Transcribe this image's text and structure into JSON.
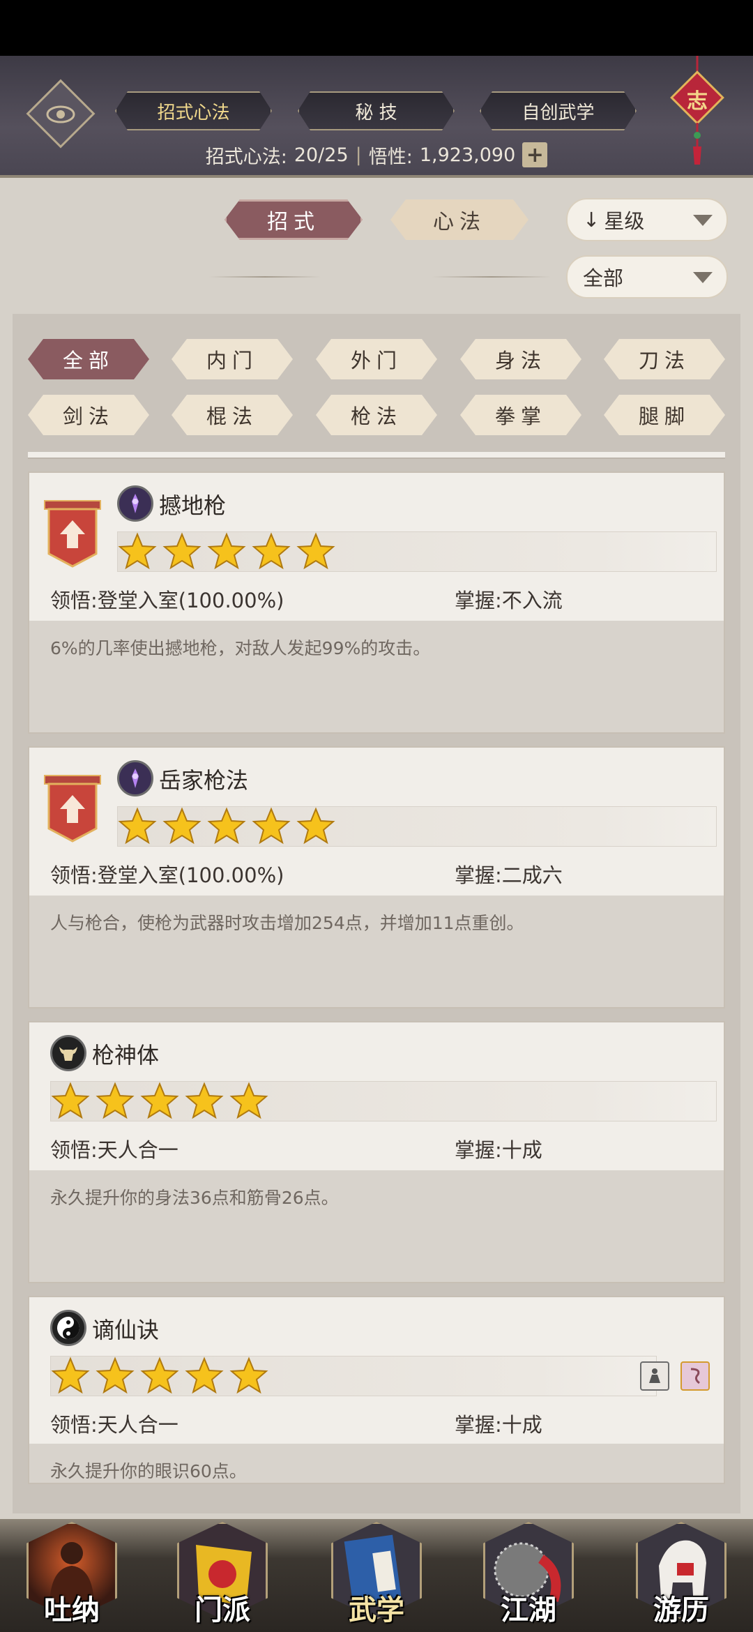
{
  "header": {
    "tabs": [
      {
        "label": "招式心法",
        "active": true
      },
      {
        "label": "秘 技",
        "active": false
      },
      {
        "label": "自创武学",
        "active": false
      }
    ],
    "knot_char": "志",
    "stats": {
      "count_label": "招式心法:",
      "count_value": "20/25",
      "insight_label": "悟性:",
      "insight_value": "1,923,090",
      "plus": "+"
    }
  },
  "subtabs": [
    {
      "label": "招式",
      "active": true
    },
    {
      "label": "心法",
      "active": false
    }
  ],
  "sort": {
    "label": "星级",
    "arrow": "↓"
  },
  "category_filter": {
    "label": "全部"
  },
  "filters": [
    "全部",
    "内门",
    "外门",
    "身法",
    "刀法",
    "剑法",
    "棍法",
    "枪法",
    "拳掌",
    "腿脚"
  ],
  "active_filter": "全部",
  "labels": {
    "comprehension": "领悟:",
    "mastery": "掌握:"
  },
  "skills": [
    {
      "name": "撼地枪",
      "icon": "spear-purple-icon",
      "stars": 5,
      "comprehension": "登堂入室(100.00%)",
      "mastery": "不入流",
      "description": "6%的几率使出撼地枪，对敌人发起99%的攻击。",
      "has_badge": true
    },
    {
      "name": "岳家枪法",
      "icon": "spear-purple-icon",
      "stars": 5,
      "comprehension": "登堂入室(100.00%)",
      "mastery": "二成六",
      "description": "人与枪合，使枪为武器时攻击增加254点，并增加11点重创。",
      "has_badge": true
    },
    {
      "name": "枪神体",
      "icon": "bull-head-icon",
      "stars": 5,
      "comprehension": "天人合一",
      "mastery": "十成",
      "description": "永久提升你的身法36点和筋骨26点。",
      "has_badge": false
    },
    {
      "name": "谪仙诀",
      "icon": "yin-yang-icon",
      "stars": 5,
      "comprehension": "天人合一",
      "mastery": "十成",
      "description": "永久提升你的眼识60点。",
      "has_badge": false
    }
  ],
  "nav": [
    {
      "label": "吐纳",
      "icon": "meditating-monk-icon",
      "active": false
    },
    {
      "label": "门派",
      "icon": "sect-banner-icon",
      "active": false
    },
    {
      "label": "武学",
      "icon": "martial-book-icon",
      "active": true
    },
    {
      "label": "江湖",
      "icon": "net-icon",
      "active": false
    },
    {
      "label": "游历",
      "icon": "horse-icon",
      "active": false
    }
  ],
  "colors": {
    "accent": "#8a5b60",
    "gold": "#f1d98c",
    "star": "#f6c21c"
  }
}
